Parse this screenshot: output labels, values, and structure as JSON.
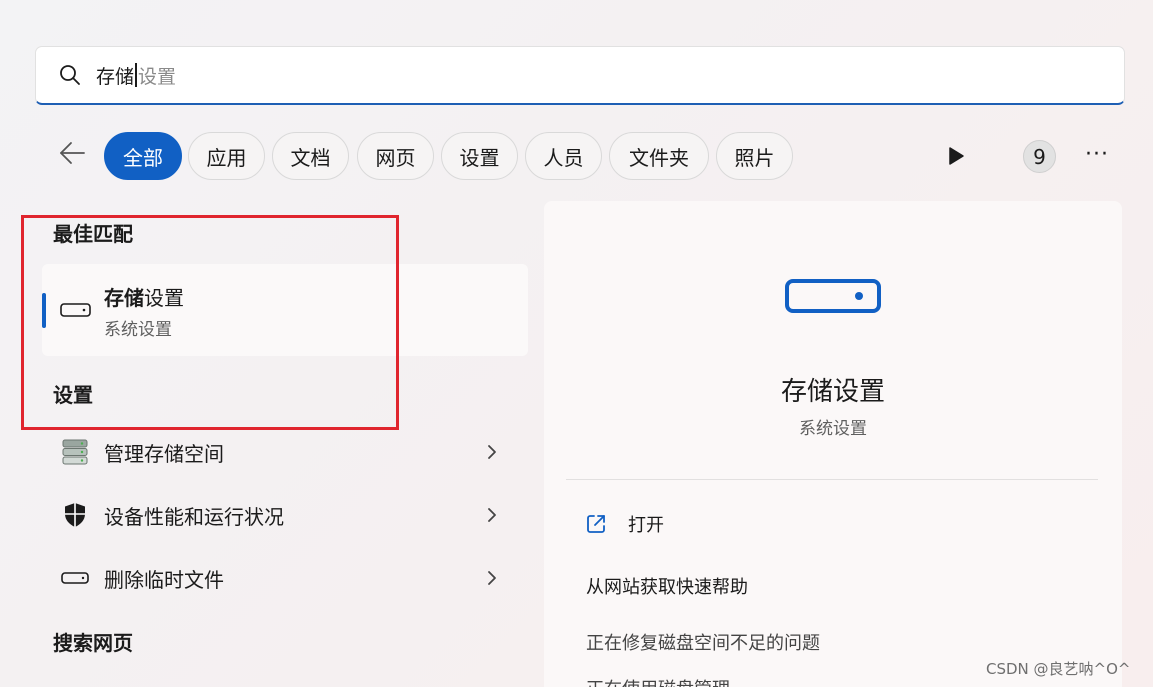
{
  "search": {
    "typed": "存储",
    "suggestion": "设置"
  },
  "filters": [
    "全部",
    "应用",
    "文档",
    "网页",
    "设置",
    "人员",
    "文件夹",
    "照片"
  ],
  "filters_active": "全部",
  "badge_count": "9",
  "more_label": "···",
  "sections": {
    "best_match": "最佳匹配",
    "settings": "设置",
    "web": "搜索网页"
  },
  "best_match": {
    "title_bold": "存储",
    "title_rest": "设置",
    "subtitle": "系统设置"
  },
  "settings_items": [
    {
      "label": "管理存储空间",
      "icon": "storage-spaces-icon"
    },
    {
      "label": "设备性能和运行状况",
      "icon": "shield-icon"
    },
    {
      "label": "删除临时文件",
      "icon": "drive-icon"
    }
  ],
  "detail": {
    "title": "存储设置",
    "subtitle": "系统设置",
    "open_label": "打开",
    "help_heading": "从网站获取快速帮助",
    "help_links": [
      "正在修复磁盘空间不足的问题",
      "正在使用磁盘管理"
    ]
  },
  "watermark": "CSDN @良艺呐^O^",
  "colors": {
    "accent": "#1160c4",
    "highlight": "#e0252e"
  }
}
